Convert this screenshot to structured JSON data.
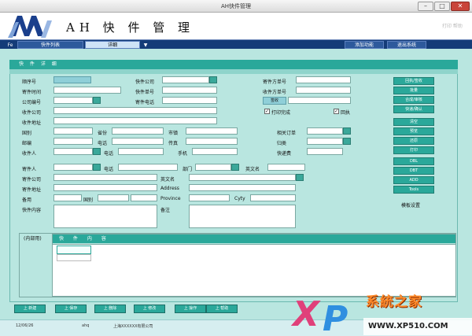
{
  "window": {
    "title": "AH快件管理",
    "min": "–",
    "max": "□",
    "close": "✕"
  },
  "banner": {
    "logo_text": "AH",
    "title": "AH 快 件 管 理",
    "help": "打印 帮助"
  },
  "tabs": [
    {
      "label": "Fe"
    },
    {
      "label": "快件列表"
    },
    {
      "label": "详细"
    },
    {
      "label": "▼"
    },
    {
      "label": "添加功能"
    },
    {
      "label": "退出系统"
    }
  ],
  "panel": {
    "header": "快 件 详 细"
  },
  "fields": {
    "c1": [
      "顺序号",
      "寄件时间",
      "公司编号",
      "收件公司",
      "收件地址"
    ],
    "gw": [
      "国别",
      "邮编",
      "收件人"
    ],
    "mid_row": [
      "省份",
      "电话",
      "电话"
    ],
    "city_row": [
      "市镇",
      "传真",
      "手机"
    ],
    "c2": [
      "快件公司",
      "快件单号",
      "寄件电话"
    ],
    "c3": [
      "寄件方单号",
      "收件方单号",
      "签收"
    ],
    "print_ok": "打印完成",
    "reply": "回执",
    "c4": [
      "相关订单",
      "归类",
      "快递费"
    ],
    "sender": [
      "寄件人",
      "电话",
      "部门",
      "英文名"
    ],
    "sender_rows": [
      "寄件公司",
      "寄件地址",
      "备用",
      "快件内容"
    ],
    "en_labels": [
      "英文名",
      "Address",
      "Province",
      "Cyty",
      "备注"
    ],
    "backup_mid": "国别"
  },
  "side_buttons": [
    "回执/签收",
    "批量",
    "合成/审核",
    "快递/确认",
    "清空",
    "预览",
    "还原",
    "打印",
    "DBL",
    "DBT",
    "ADD",
    "Tools"
  ],
  "side_caption": "模板设置",
  "internal": {
    "label": "(内部用)",
    "head": "快 件 内 容"
  },
  "bottom_buttons": [
    "上 新建",
    "上 保存",
    "上 删除",
    "上 修改",
    "上 操作",
    "上 帮助"
  ],
  "status": {
    "date": "12/06/26",
    "user": "ahq",
    "company": "上海XXXXXX有限公司"
  },
  "watermark": {
    "xp": "XP",
    "brand": "系統之家",
    "url": "WWW.XP510.COM"
  },
  "colors": {
    "accent": "#2aa89a",
    "panel": "#b9e6e0",
    "tabbar": "#143c78"
  }
}
